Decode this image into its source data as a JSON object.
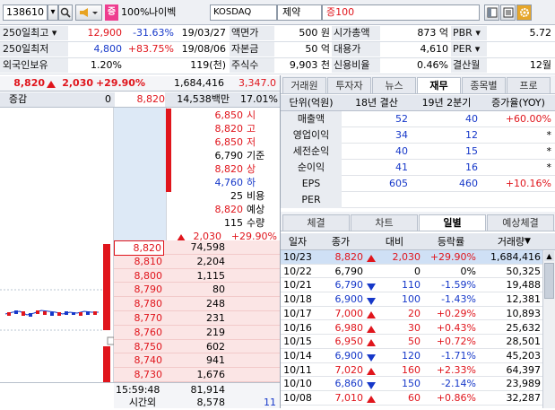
{
  "toolbar": {
    "code": "138610",
    "zoom": "100%",
    "name": "나이벡",
    "market": "KOSDAQ",
    "sector": "제약",
    "margin": "증100",
    "badge": "증"
  },
  "info": {
    "r1": {
      "l1": "250일최고",
      "v1": "12,900",
      "p1": "-31.63%",
      "d1": "19/03/27",
      "l2": "액면가",
      "v2": "500 원",
      "l3": "시가총액",
      "v3": "873 억",
      "l4": "PBR",
      "v4": "5.72"
    },
    "r2": {
      "l1": "250일최저",
      "v1": "4,800",
      "p1": "+83.75%",
      "d1": "19/08/06",
      "l2": "자본금",
      "v2": "50 억",
      "l3": "대용가",
      "v3": "4,610",
      "l4": "PER",
      "v4": ""
    },
    "r3": {
      "l1": "외국인보유",
      "v1": "1.20%",
      "v1b": "119(천)",
      "l2": "주식수",
      "v2": "9,903 천",
      "l3": "신용비율",
      "v3": "0.46%",
      "l4": "결산월",
      "v4": "12월"
    }
  },
  "quote": {
    "price": "8,820",
    "change": "2,030",
    "rate": "+29.90%",
    "volume": "1,684,416",
    "amount": "3,347.0"
  },
  "orderbook": {
    "head": {
      "label": "증감",
      "zero": "0",
      "price": "8,820",
      "amount": "14,538백만",
      "ratio": "17.01%"
    },
    "summary": [
      {
        "v": "6,850",
        "k": "시",
        "cls": "up"
      },
      {
        "v": "8,820",
        "k": "고",
        "cls": "up"
      },
      {
        "v": "6,850",
        "k": "저",
        "cls": "up"
      },
      {
        "v": "6,790",
        "k": "기준",
        "cls": ""
      },
      {
        "v": "8,820",
        "k": "상",
        "cls": "up"
      },
      {
        "v": "4,760",
        "k": "하",
        "cls": "dn"
      },
      {
        "v": "25",
        "k": "비용",
        "cls": ""
      }
    ],
    "expect": {
      "price": "8,820",
      "price_label": "예상",
      "qty": "115",
      "qty_label": "수량",
      "chg": "2,030",
      "rate": "+29.90%"
    },
    "bids": [
      {
        "p": "8,820",
        "q": "74,598"
      },
      {
        "p": "8,810",
        "q": "2,204"
      },
      {
        "p": "8,800",
        "q": "1,115"
      },
      {
        "p": "8,790",
        "q": "80"
      },
      {
        "p": "8,780",
        "q": "248"
      },
      {
        "p": "8,770",
        "q": "231"
      },
      {
        "p": "8,760",
        "q": "219"
      },
      {
        "p": "8,750",
        "q": "602"
      },
      {
        "p": "8,740",
        "q": "941"
      },
      {
        "p": "8,730",
        "q": "1,676"
      }
    ],
    "foot": {
      "time": "15:59:48",
      "total": "81,914",
      "t2label": "시간외",
      "t2": "8,578",
      "t3": "11"
    }
  },
  "tabs1": [
    "거래원",
    "투자자",
    "뉴스",
    "재무",
    "종목별",
    "프로"
  ],
  "fin": {
    "headers": [
      "단위(억원)",
      "18년 결산",
      "19년 2분기",
      "증가율(YOY)"
    ],
    "rows": [
      {
        "k": "매출액",
        "a": "52",
        "b": "40",
        "c": "+60.00%",
        "cc": "up"
      },
      {
        "k": "영업이익",
        "a": "34",
        "b": "12",
        "c": "*",
        "cc": ""
      },
      {
        "k": "세전순익",
        "a": "40",
        "b": "15",
        "c": "*",
        "cc": ""
      },
      {
        "k": "순이익",
        "a": "41",
        "b": "16",
        "c": "*",
        "cc": ""
      },
      {
        "k": "EPS",
        "a": "605",
        "b": "460",
        "c": "+10.16%",
        "cc": "up"
      },
      {
        "k": "PER",
        "a": "",
        "b": "",
        "c": "",
        "cc": ""
      }
    ]
  },
  "tabs2": [
    "체결",
    "차트",
    "일별",
    "예상체결"
  ],
  "daily": {
    "headers": [
      "일자",
      "종가",
      "대비",
      "등락률",
      "거래량"
    ],
    "rows": [
      {
        "d": "10/23",
        "p": "8,820",
        "t": "u",
        "c": "2,030",
        "r": "+29.90%",
        "v": "1,684,416",
        "s": "up"
      },
      {
        "d": "10/22",
        "p": "6,790",
        "t": "",
        "c": "0",
        "r": "0%",
        "v": "50,325",
        "s": ""
      },
      {
        "d": "10/21",
        "p": "6,790",
        "t": "d",
        "c": "110",
        "r": "-1.59%",
        "v": "19,488",
        "s": "dn"
      },
      {
        "d": "10/18",
        "p": "6,900",
        "t": "d",
        "c": "100",
        "r": "-1.43%",
        "v": "12,381",
        "s": "dn"
      },
      {
        "d": "10/17",
        "p": "7,000",
        "t": "u",
        "c": "20",
        "r": "+0.29%",
        "v": "10,893",
        "s": "up"
      },
      {
        "d": "10/16",
        "p": "6,980",
        "t": "u",
        "c": "30",
        "r": "+0.43%",
        "v": "25,632",
        "s": "up"
      },
      {
        "d": "10/15",
        "p": "6,950",
        "t": "u",
        "c": "50",
        "r": "+0.72%",
        "v": "28,501",
        "s": "up"
      },
      {
        "d": "10/14",
        "p": "6,900",
        "t": "d",
        "c": "120",
        "r": "-1.71%",
        "v": "45,203",
        "s": "dn"
      },
      {
        "d": "10/11",
        "p": "7,020",
        "t": "u",
        "c": "160",
        "r": "+2.33%",
        "v": "64,397",
        "s": "up"
      },
      {
        "d": "10/10",
        "p": "6,860",
        "t": "d",
        "c": "150",
        "r": "-2.14%",
        "v": "23,989",
        "s": "dn"
      },
      {
        "d": "10/08",
        "p": "7,010",
        "t": "u",
        "c": "60",
        "r": "+0.86%",
        "v": "32,287",
        "s": "up"
      }
    ]
  },
  "colors": {
    "up": "#e0151c",
    "down": "#1638c9"
  }
}
